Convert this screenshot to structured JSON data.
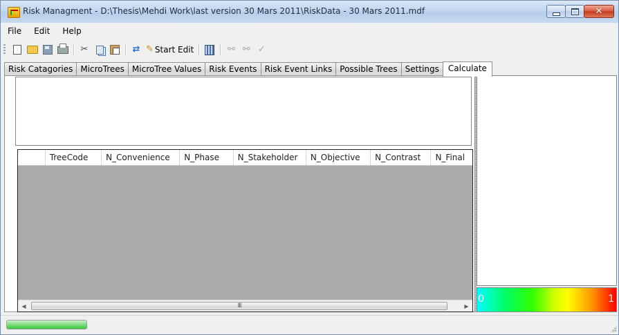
{
  "window": {
    "title": "Risk Managment - D:\\Thesis\\Mehdi Work\\last version 30 Mars 2011\\RiskData - 30 Mars 2011.mdf",
    "buttons": [
      "minimize",
      "maximize",
      "close"
    ],
    "close_glyph": "✕"
  },
  "menu": {
    "items": [
      "File",
      "Edit",
      "Help"
    ]
  },
  "toolbar": {
    "icons": [
      "new-icon",
      "open-icon",
      "save-icon",
      "print-icon",
      "cut-icon",
      "copy-icon",
      "paste-icon",
      "refresh-icon",
      "edit-pencil-icon",
      "calculator-icon",
      "link-icon",
      "unlink-icon",
      "check-icon"
    ],
    "cut_glyph": "✂",
    "refresh_glyph": "⇄",
    "pencil_glyph": "✎",
    "link_glyph": "⚯",
    "unlink_glyph": "⚯",
    "check_glyph": "✓",
    "start_edit_label": "Start Edit"
  },
  "tabs": [
    {
      "label": "Risk Catagories",
      "active": false
    },
    {
      "label": "MicroTrees",
      "active": false
    },
    {
      "label": "MicroTree Values",
      "active": false
    },
    {
      "label": "Risk Events",
      "active": false
    },
    {
      "label": "Risk Event Links",
      "active": false
    },
    {
      "label": "Possible Trees",
      "active": false
    },
    {
      "label": "Settings",
      "active": false
    },
    {
      "label": "Calculate",
      "active": true
    }
  ],
  "grid": {
    "columns": [
      "TreeCode",
      "N_Convenience",
      "N_Phase",
      "N_Stakeholder",
      "N_Objective",
      "N_Contrast",
      "N_Final"
    ],
    "rows": [],
    "scroll": {
      "left_arrow": "◀",
      "right_arrow": "▶",
      "thumb_grip": "III"
    }
  },
  "legend": {
    "min_label": "0",
    "max_label": "1"
  },
  "status": {
    "progress_percent": 100
  },
  "colors": {
    "grid_background": "#ababab",
    "gradient": [
      "#00ffff",
      "#00ff66",
      "#ffff00",
      "#ff0000"
    ]
  }
}
